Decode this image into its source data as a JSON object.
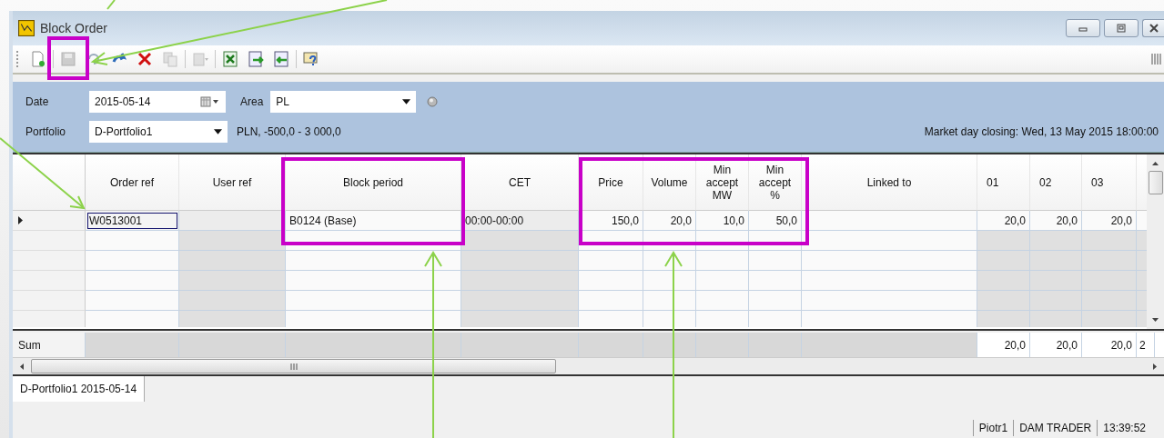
{
  "window": {
    "title": "Block Order"
  },
  "toolbar": [
    {
      "kind": "new",
      "disabled": false
    },
    {
      "kind": "sep"
    },
    {
      "kind": "save",
      "disabled": true
    },
    {
      "kind": "undo",
      "disabled": false
    },
    {
      "kind": "redo",
      "disabled": false
    },
    {
      "kind": "delete",
      "disabled": false
    },
    {
      "kind": "copy",
      "disabled": true
    },
    {
      "kind": "sep"
    },
    {
      "kind": "paste",
      "disabled": true
    },
    {
      "kind": "sep"
    },
    {
      "kind": "excel",
      "disabled": false
    },
    {
      "kind": "import",
      "disabled": false
    },
    {
      "kind": "export",
      "disabled": false
    },
    {
      "kind": "sep"
    },
    {
      "kind": "help",
      "disabled": false
    }
  ],
  "form": {
    "date": {
      "label": "Date",
      "value": "2015-05-14"
    },
    "area": {
      "label": "Area",
      "value": "PL"
    },
    "portfolio": {
      "label": "Portfolio",
      "value": "D-Portfolio1"
    },
    "limits": "PLN, -500,0 - 3 000,0",
    "market_closing": "Market day closing: Wed, 13 May 2015 18:00:00"
  },
  "table": {
    "columns": [
      {
        "label": "Order ref",
        "kind": "text"
      },
      {
        "label": "User ref",
        "kind": "computed"
      },
      {
        "label": "Block period",
        "kind": "text"
      },
      {
        "label": "CET",
        "kind": "computed"
      },
      {
        "label": "Price",
        "kind": "number"
      },
      {
        "label": "Volume",
        "kind": "number"
      },
      {
        "label": "Min\naccept\nMW",
        "kind": "number"
      },
      {
        "label": "Min\naccept\n%",
        "kind": "number"
      },
      {
        "label": "Linked to",
        "kind": "text"
      },
      {
        "label": "01",
        "kind": "hour"
      },
      {
        "label": "02",
        "kind": "hour"
      },
      {
        "label": "03",
        "kind": "hour"
      }
    ],
    "rows": [
      {
        "selected": true,
        "cells": [
          {
            "text": "W0513001",
            "focused": true
          },
          null,
          {
            "text": "B0124 (Base)",
            "focused": false
          },
          {
            "text": "00:00-00:00",
            "focused": false
          },
          {
            "text": "150,0",
            "focused": false
          },
          {
            "text": "20,0",
            "focused": false
          },
          {
            "text": "10,0",
            "focused": false
          },
          {
            "text": "50,0",
            "focused": false
          },
          null,
          {
            "text": "20,0",
            "focused": false
          },
          {
            "text": "20,0",
            "focused": false
          },
          {
            "text": "20,0",
            "focused": false
          }
        ]
      }
    ],
    "sum": {
      "label": "Sum",
      "cells": [
        null,
        null,
        null,
        null,
        null,
        null,
        null,
        null,
        null,
        "20,0",
        "20,0",
        "20,0",
        "2"
      ]
    }
  },
  "tabs": [
    {
      "label": "D-Portfolio1 2015-05-14",
      "selected": true
    }
  ],
  "status_bar": [
    "Piotr1",
    "DAM TRADER",
    "13:39:52"
  ]
}
